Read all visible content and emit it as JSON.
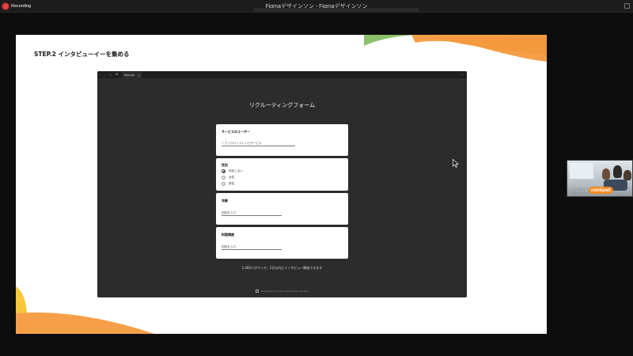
{
  "app": {
    "recording_label": "Recording",
    "window_title": "Figmaデザインソン - Figmaデザインソン"
  },
  "slide": {
    "title": "STEP.2 インタビューイーを集める"
  },
  "prototype": {
    "tab_label": "New tab",
    "tab_close": "×",
    "home_icon": "home-icon",
    "menu_icon": "more-icon",
    "heading": "リクルーティングフォーム",
    "service_card": {
      "label": "サービスのユーザー",
      "value": "✓ クックパッドレシピサービス"
    },
    "gender_card": {
      "label": "性別",
      "options": [
        {
          "label": "特定しない",
          "checked": true
        },
        {
          "label": "女性",
          "checked": false
        },
        {
          "label": "男性",
          "checked": false
        }
      ]
    },
    "age_card": {
      "label": "年齢",
      "placeholder": "回答を入力"
    },
    "cooking_card": {
      "label": "料理頻度",
      "placeholder": "回答を入力"
    },
    "match_text": "1,460人がマッチ。2日以内にインタビュー開始できます",
    "remember_text": "Remember my choice and skip this next time"
  },
  "participant": {
    "name": "クックパッド",
    "logo_text": "cookpad"
  },
  "colors": {
    "slide_accent_orange": "#F5A049",
    "slide_accent_green": "#8CC06A",
    "slide_accent_yellow": "#F8C73A",
    "brand_orange": "#F58A1F"
  }
}
